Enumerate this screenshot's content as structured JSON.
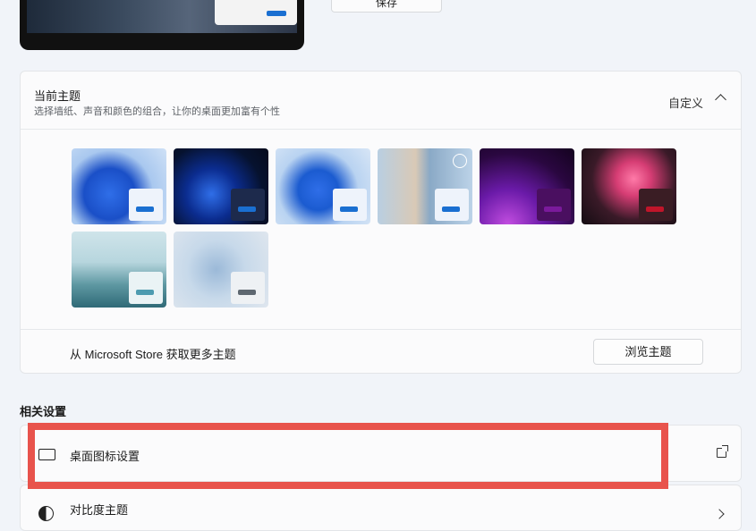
{
  "top": {
    "save_label": "保存"
  },
  "current_theme": {
    "title": "当前主题",
    "subtitle": "选择墙纸、声音和颜色的组合，让你的桌面更加富有个性",
    "custom_label": "自定义",
    "themes": [
      {
        "name": "windows-light-bloom",
        "accent": "#1a6fd1",
        "mini_bg": "#eef3fb"
      },
      {
        "name": "windows-dark-bloom",
        "accent": "#1a6fd1",
        "mini_bg": "#1d2a4c"
      },
      {
        "name": "windows-glow",
        "accent": "#1a6fd1",
        "mini_bg": "#eef3fb"
      },
      {
        "name": "captured-motion",
        "accent": "#1a6fd1",
        "mini_bg": "#eef3fb"
      },
      {
        "name": "glow-purple",
        "accent": "#7a1a9b",
        "mini_bg": "#4a0f60"
      },
      {
        "name": "sunrise-flower",
        "accent": "#c0152a",
        "mini_bg": "#3a1d24"
      },
      {
        "name": "lake",
        "accent": "#4d9bb0",
        "mini_bg": "#eaf3f5"
      },
      {
        "name": "flow",
        "accent": "#5d6770",
        "mini_bg": "#eef1f4"
      }
    ],
    "store_text": "从 Microsoft Store 获取更多主题",
    "browse_label": "浏览主题"
  },
  "related": {
    "title": "相关设置",
    "desktop_icons_label": "桌面图标设置",
    "contrast_label": "对比度主题"
  },
  "colors": {
    "highlight": "#e8534c",
    "accent": "#1a6fd1"
  }
}
